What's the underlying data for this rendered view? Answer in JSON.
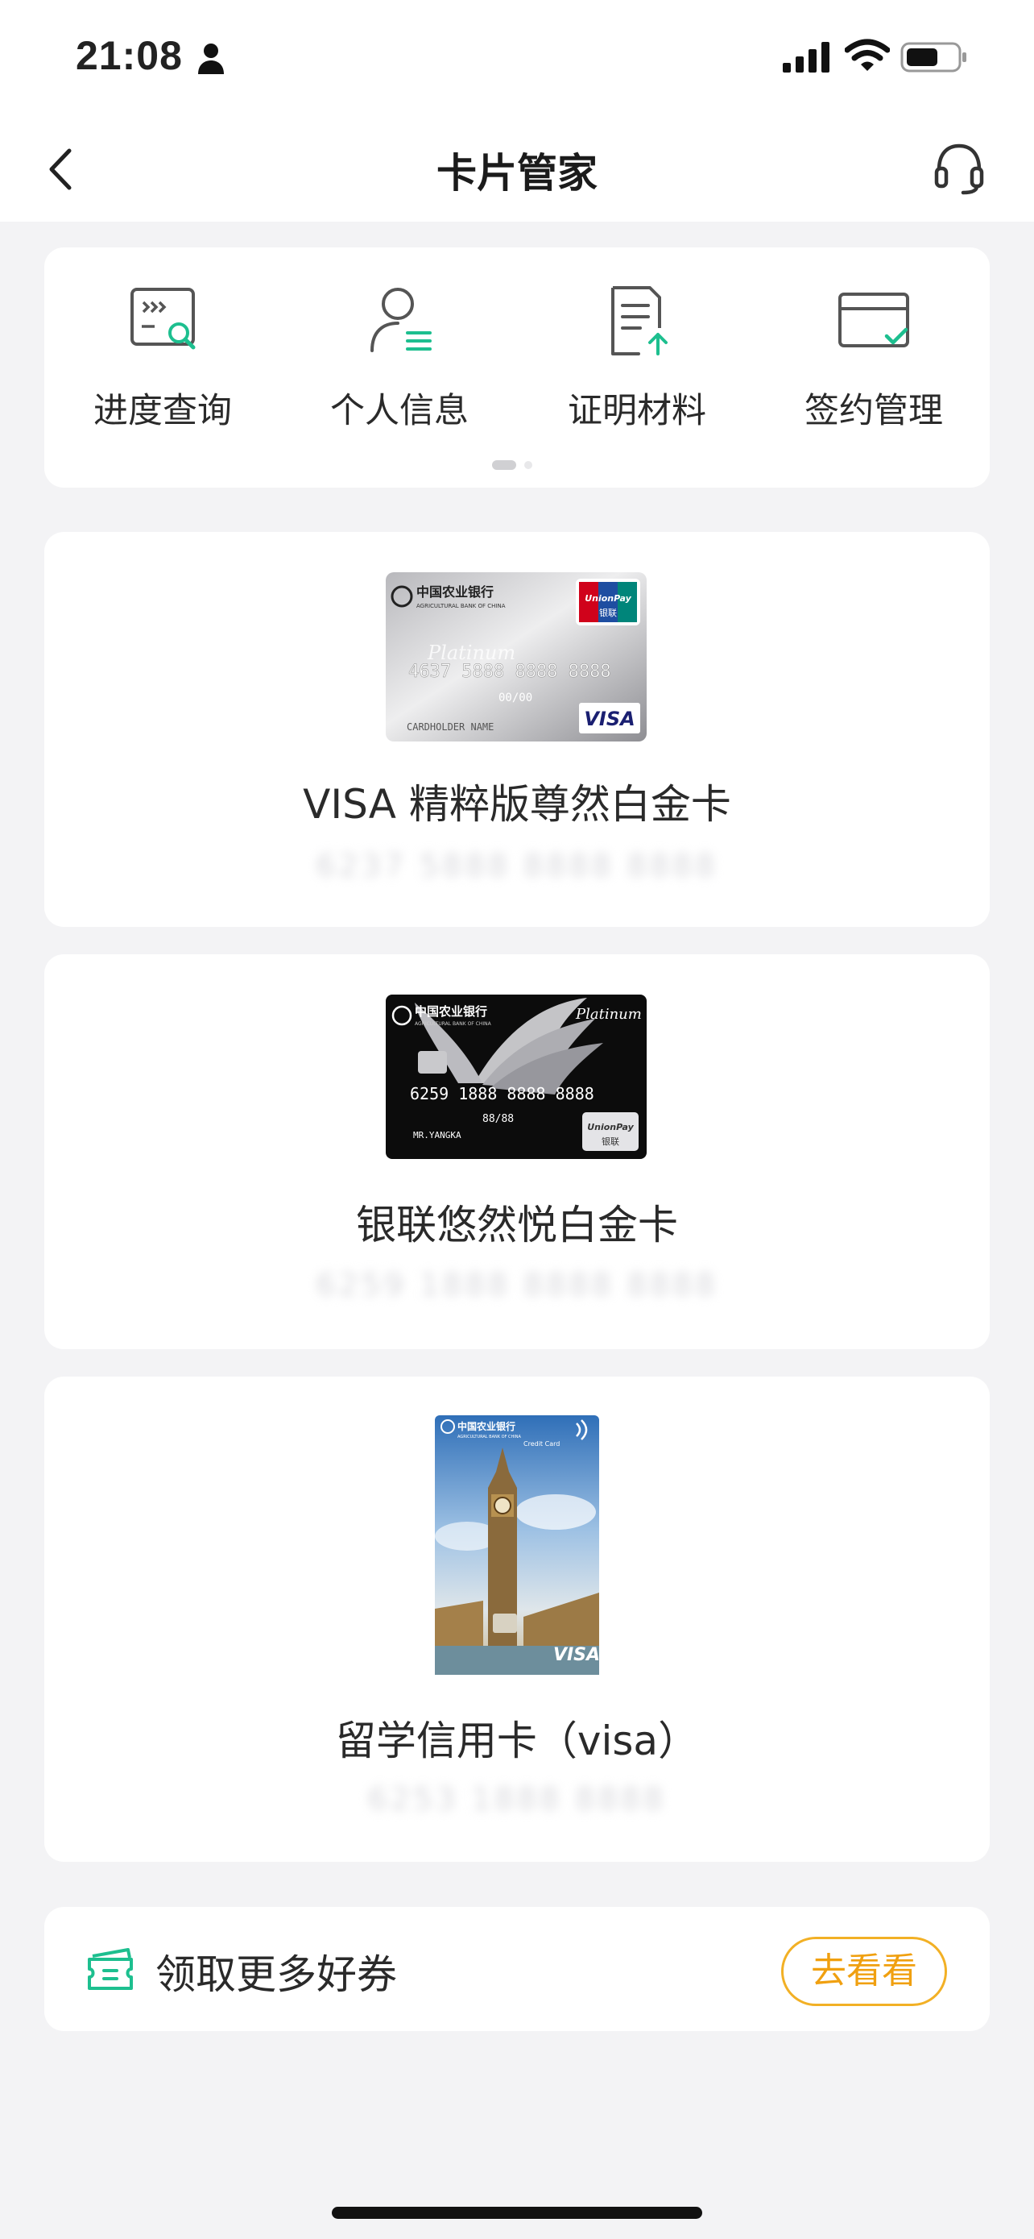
{
  "status_bar": {
    "time": "21:08",
    "icons": [
      "person-icon",
      "signal-icon",
      "wifi-icon",
      "battery-icon"
    ]
  },
  "nav": {
    "title": "卡片管家",
    "icons": [
      "back-icon",
      "customer-service-icon"
    ]
  },
  "quick_actions": [
    {
      "label": "进度查询",
      "icon": "progress-search-icon"
    },
    {
      "label": "个人信息",
      "icon": "personal-info-icon"
    },
    {
      "label": "证明材料",
      "icon": "document-upload-icon"
    },
    {
      "label": "签约管理",
      "icon": "card-signing-icon"
    }
  ],
  "pager": {
    "pages": 2,
    "active": 1
  },
  "cards": [
    {
      "name": "VISA 精粹版尊然白金卡",
      "number": "6237 5888 8888 8888",
      "art": {
        "bank_name": "中国农业银行",
        "bank_name_en": "AGRICULTURAL BANK OF CHINA",
        "network_logo": "UnionPay",
        "network_logo_cn": "银联",
        "tier": "Platinum",
        "card_number": "4637 5888 8888 8888",
        "expiry": "00/00",
        "holder": "CARDHOLDER NAME",
        "brand": "VISA"
      }
    },
    {
      "name": "银联悠然悦白金卡",
      "number": "6259 1888 8888 8888",
      "art": {
        "bank_name": "中国农业银行",
        "bank_name_en": "AGRICULTURAL BANK OF CHINA",
        "tier": "Platinum",
        "card_number": "6259 1888 8888 8888",
        "expiry": "88/88",
        "holder": "MR.YANGKA",
        "network_logo": "UnionPay",
        "network_logo_cn": "银联"
      }
    },
    {
      "name": "留学信用卡（visa）",
      "number": "6253 1888 8888",
      "art": {
        "bank_name": "中国农业银行",
        "bank_name_en": "AGRICULTURAL BANK OF CHINA",
        "sub": "Credit Card",
        "brand": "VISA"
      }
    }
  ],
  "coupon": {
    "label": "领取更多好券",
    "button": "去看看",
    "icon": "coupon-icon"
  },
  "colors": {
    "accent_green": "#1dbf8f",
    "coupon_orange": "#f2b025",
    "background": "#f3f3f5"
  }
}
